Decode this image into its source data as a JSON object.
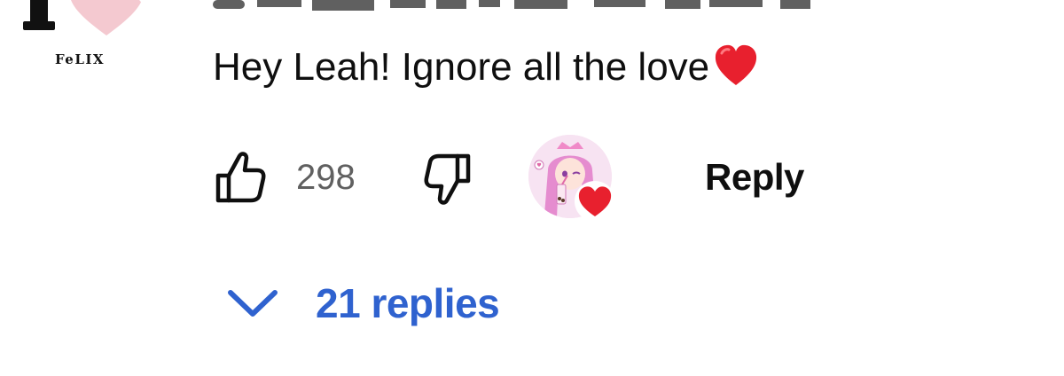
{
  "commenter": {
    "avatar_brand_text": "FeLIX"
  },
  "comment": {
    "text": "Hey Leah! Ignore all the love",
    "emoji": "red-heart"
  },
  "actions": {
    "like_count": "298",
    "reply_label": "Reply"
  },
  "replies": {
    "label": "21 replies"
  },
  "colors": {
    "link_blue": "#2f62cf",
    "heart_red": "#e8202e",
    "muted_gray": "#606060",
    "pink_heart": "#f4c9d0"
  },
  "icons": {
    "like": "thumbs-up-icon",
    "dislike": "thumbs-down-icon",
    "expand": "chevron-down-icon",
    "creator_heart": "heart-icon"
  }
}
